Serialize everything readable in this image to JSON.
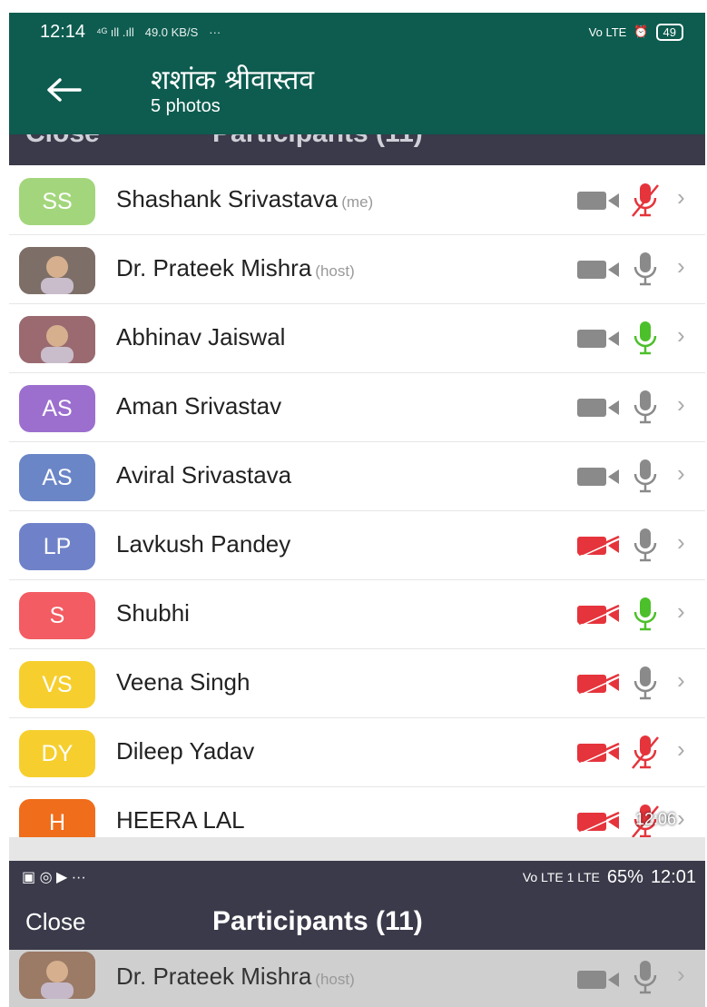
{
  "status_top": {
    "time": "12:14",
    "signal": "⁴ᴳ ıll .ıll",
    "speed": "49.0 KB/S",
    "dots": "···",
    "right_label": "Vo LTE",
    "alarm": "⏰",
    "battery": "49"
  },
  "header": {
    "title": "शशांक श्रीवास्तव",
    "subtitle": "5 photos"
  },
  "participants": [
    {
      "initials": "SS",
      "name": "Shashank Srivastava",
      "tag": "(me)",
      "color": "#a3d67c",
      "video": "off-gray",
      "mic": "muted"
    },
    {
      "initials": "",
      "name": "Dr. Prateek Mishra",
      "tag": "(host)",
      "color": "#7d6f68",
      "photo": true,
      "video": "off-gray",
      "mic": "gray"
    },
    {
      "initials": "",
      "name": "Abhinav Jaiswal",
      "tag": "",
      "color": "#9a6a70",
      "photo": true,
      "video": "off-gray",
      "mic": "green"
    },
    {
      "initials": "AS",
      "name": "Aman Srivastav",
      "tag": "",
      "color": "#9c6fcf",
      "video": "off-gray",
      "mic": "gray"
    },
    {
      "initials": "AS",
      "name": "Aviral Srivastava",
      "tag": "",
      "color": "#6b86c7",
      "video": "off-gray",
      "mic": "gray"
    },
    {
      "initials": "LP",
      "name": "Lavkush Pandey",
      "tag": "",
      "color": "#6f82c9",
      "video": "red",
      "mic": "gray"
    },
    {
      "initials": "S",
      "name": "Shubhi",
      "tag": "",
      "color": "#f25c62",
      "video": "red",
      "mic": "green"
    },
    {
      "initials": "VS",
      "name": "Veena Singh",
      "tag": "",
      "color": "#f6cf2f",
      "video": "red",
      "mic": "gray"
    },
    {
      "initials": "DY",
      "name": "Dileep Yadav",
      "tag": "",
      "color": "#f6cf2f",
      "video": "red",
      "mic": "muted"
    },
    {
      "initials": "H",
      "name": "HEERA LAL",
      "tag": "",
      "color": "#f06d1b",
      "video": "red",
      "mic": "muted",
      "timestamp": "12:06"
    }
  ],
  "status_bottom": {
    "icons": "▣ ◎ ▶ ···",
    "right": "65%",
    "time": "12:01",
    "network": "Vo LTE 1 LTE"
  },
  "zoom_header": {
    "close": "Close",
    "title": "Participants (11)"
  },
  "last_row": {
    "name": "Dr. Prateek Mishra",
    "tag": "(host)"
  }
}
